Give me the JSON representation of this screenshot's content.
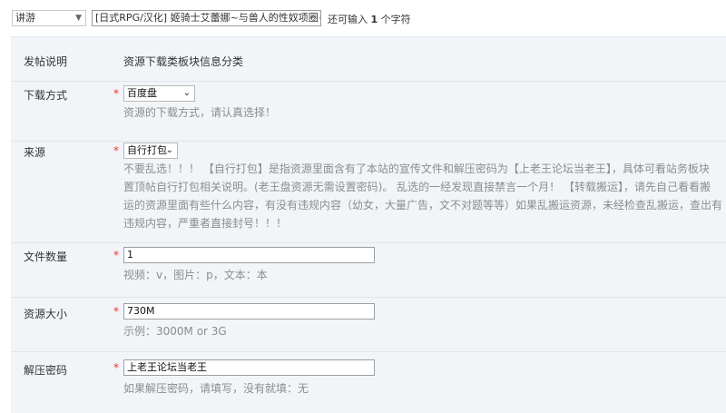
{
  "top": {
    "category_select": "讲游",
    "title_value": "[日式RPG/汉化] 姬骑士艾蕾娜~与兽人的性奴项圈~ AI汉化",
    "remain_prefix": "还可输入 ",
    "remain_count": "1",
    "remain_suffix": " 个字符"
  },
  "form": {
    "description": {
      "label": "发帖说明",
      "text": "资源下载类板块信息分类"
    },
    "download_method": {
      "label": "下载方式",
      "required": "*",
      "value": "百度盘",
      "hint": "资源的下载方式，请认真选择！"
    },
    "source": {
      "label": "来源",
      "required": "*",
      "value": "自行打包",
      "hint_lines": [
        "不要乱选！！！ 【自行打包】是指资源里面含有了本站的宣传文件和解压密码为【上老王论坛当老王】，具体可看站务板块",
        "置顶帖自行打包相关说明。(老王盘资源无需设置密码)。 乱选的一经发现直接禁言一个月！ 【转载搬运】，请先自己看看搬",
        "运的资源里面有些什么内容，有没有违规内容（幼女，大量广告，文不对题等等）如果乱搬运资源，未经检查乱搬运，查出有",
        "违规内容，严重者直接封号！！！"
      ]
    },
    "file_count": {
      "label": "文件数量",
      "required": "*",
      "value": "1",
      "hint": "视频：v，图片：p，文本：本"
    },
    "resource_size": {
      "label": "资源大小",
      "required": "*",
      "value": "730M",
      "hint": "示例：3000M or 3G"
    },
    "unzip_password": {
      "label": "解压密码",
      "required": "*",
      "value": "上老王论坛当老王",
      "hint": "如果解压密码，请填写，没有就填：无"
    }
  }
}
